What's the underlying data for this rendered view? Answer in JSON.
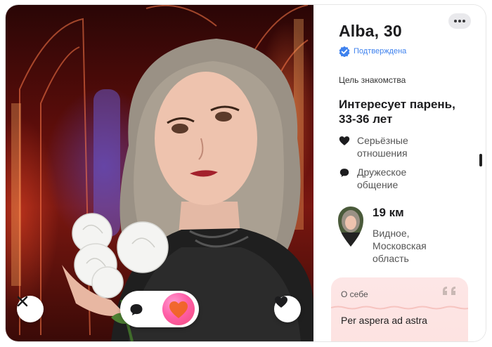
{
  "profile": {
    "name_age": "Alba, 30",
    "verified_label": "Подтверждена",
    "goal_label": "Цель знакомства",
    "interest": "Интересует парень, 33-36 лет",
    "tags": [
      {
        "icon": "heart-icon",
        "label": "Серьёзные отношения"
      },
      {
        "icon": "chat-bubble-icon",
        "label": "Дружеское общение"
      }
    ],
    "distance": "19 км",
    "city": "Видное, Московская область",
    "about_label": "О себе",
    "about_text": "Per aspera ad astra"
  },
  "colors": {
    "verified": "#3f82ee",
    "about_bg": "#fde6e6",
    "superlike": "#ff5fa8",
    "superlike_heart": "#f0641e"
  },
  "actions": [
    "dislike-button",
    "message-button",
    "superlike-button",
    "like-button",
    "more-options-button"
  ]
}
